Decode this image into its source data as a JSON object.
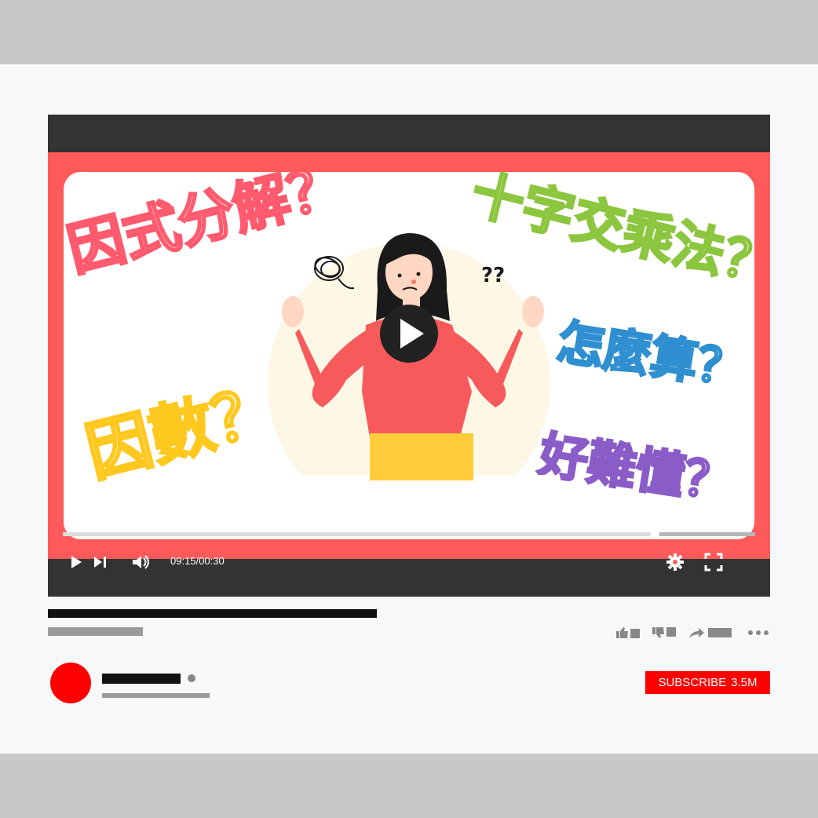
{
  "thumbnail": {
    "words": [
      "因式分解？",
      "十字交乘法？",
      "怎麼算？",
      "因數？",
      "好難懂？"
    ],
    "thought_marks": "??"
  },
  "player": {
    "time": "09:15/00:30",
    "progress": 0.855
  },
  "channel": {
    "subscribe_label": "SUBSCRIBE",
    "subscriber_count": "3.5M"
  },
  "colors": {
    "frame": "#ff5a5a",
    "player_bar": "#333333",
    "subscribe": "#ff0000",
    "avatar": "#ff0000"
  },
  "icons": [
    "play-icon",
    "next-icon",
    "volume-icon",
    "settings-gear-icon",
    "fullscreen-icon",
    "like-icon",
    "dislike-icon",
    "share-icon",
    "more-icon"
  ]
}
